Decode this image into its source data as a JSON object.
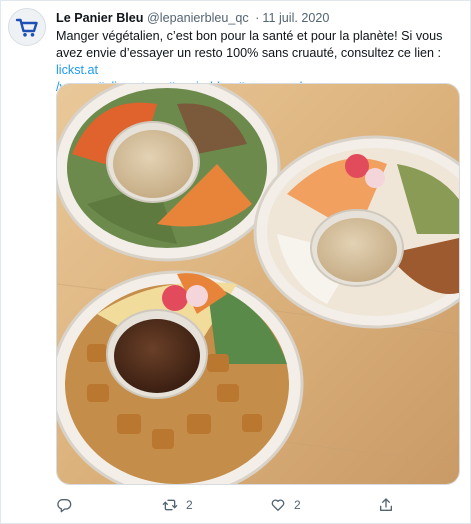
{
  "tweet": {
    "author_name": "Le Panier Bleu",
    "author_handle": "@lepanierbleu_qc",
    "separator": "·",
    "date": "11 juil. 2020",
    "text_before_link": "Manger végétalien, c’est bon pour la santé et pour la planète! Si vous avez envie d’essayer un resto 100% sans cruauté, consultez ce lien : ",
    "link": "lickst.at",
    "hashtags": "/vegan #alimentsqc #panierbleu #veganquebec"
  },
  "media": {
    "description_icon": "photo-of-three-vegan-bowls"
  },
  "actions": {
    "reply_icon": "reply-icon",
    "retweet_icon": "retweet-icon",
    "retweet_count": "2",
    "like_icon": "heart-icon",
    "like_count": "2",
    "share_icon": "share-icon"
  },
  "colors": {
    "link": "#1d9bf0",
    "secondary_text": "#536471",
    "brand_blue": "#1e4fb5"
  }
}
